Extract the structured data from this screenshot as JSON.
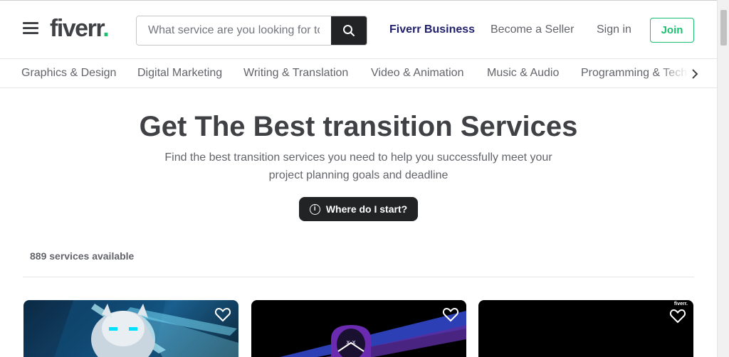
{
  "header": {
    "logo_text": "fiverr",
    "logo_dot": ".",
    "search_placeholder": "What service are you looking for today?",
    "nav": {
      "business": "Fiverr Business",
      "become_seller": "Become a Seller",
      "sign_in": "Sign in",
      "join": "Join"
    }
  },
  "categories": [
    "Graphics & Design",
    "Digital Marketing",
    "Writing & Translation",
    "Video & Animation",
    "Music & Audio",
    "Programming & Tech"
  ],
  "hero": {
    "title": "Get The Best transition Services",
    "subtitle_line1": "Find the best transition services you need to help you successfully meet your",
    "subtitle_line2": "project planning goals and deadline",
    "cta": "Where do I start?"
  },
  "results": {
    "count_text": "889 services available"
  },
  "cards": [
    {
      "watermark": ""
    },
    {
      "watermark": ""
    },
    {
      "watermark": "fiverr."
    }
  ],
  "colors": {
    "brand_green": "#1dbf73",
    "text_dark": "#404145",
    "business_navy": "#1f1e6b",
    "button_dark": "#222325"
  },
  "icons": [
    "menu-icon",
    "search-icon",
    "chevron-right-icon",
    "info-icon",
    "heart-icon"
  ]
}
